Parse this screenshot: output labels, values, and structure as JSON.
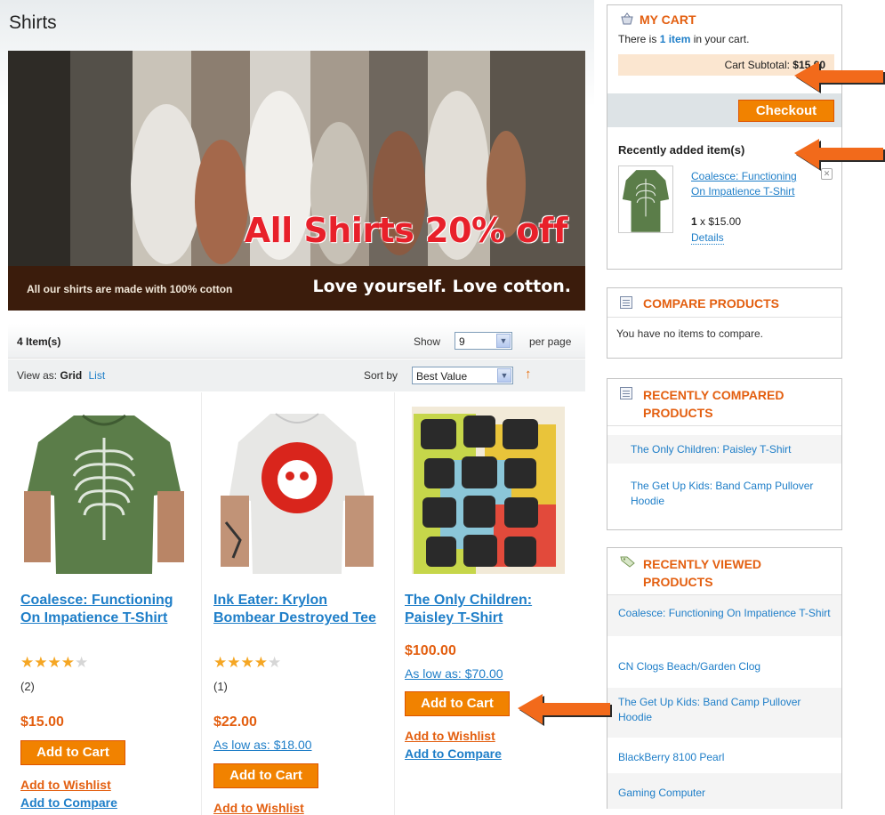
{
  "page": {
    "title": "Shirts"
  },
  "banner": {
    "headline": "All Shirts 20% off",
    "footer_left": "All our shirts are made with 100% cotton",
    "footer_right": "Love yourself. Love cotton."
  },
  "toolbar": {
    "item_count": "4 Item(s)",
    "show_label": "Show",
    "per_page_value": "9",
    "per_page_label": "per page",
    "view_as_label": "View as:",
    "view_grid": "Grid",
    "view_list": "List",
    "sort_label": "Sort by",
    "sort_value": "Best Value",
    "sort_dir_icon": "↑"
  },
  "products": [
    {
      "name": "Coalesce: Functioning On Impatience T-Shirt",
      "rating_stars": 4,
      "reviews": "(2)",
      "price": "$15.00",
      "as_low_as": "",
      "add_to_cart": "Add to Cart",
      "wishlist": "Add to Wishlist",
      "compare": "Add to Compare"
    },
    {
      "name": "Ink Eater: Krylon Bombear Destroyed Tee",
      "rating_stars": 4,
      "reviews": "(1)",
      "price": "$22.00",
      "as_low_as": "As low as: $18.00",
      "add_to_cart": "Add to Cart",
      "wishlist": "Add to Wishlist",
      "compare": ""
    },
    {
      "name": "The Only Children: Paisley T-Shirt",
      "rating_stars": 0,
      "reviews": "",
      "price": "$100.00",
      "as_low_as": "As low as: $70.00",
      "add_to_cart": "Add to Cart",
      "wishlist": "Add to Wishlist",
      "compare": "Add to Compare"
    }
  ],
  "cart": {
    "title": "MY CART",
    "text_before": "There is ",
    "item_link": "1 item",
    "text_after": " in your cart.",
    "subtotal_label": "Cart Subtotal:",
    "subtotal_value": "$15.00",
    "checkout": "Checkout",
    "recent_title": "Recently added item(s)",
    "recent_item": {
      "name": "Coalesce: Functioning On Impatience T-Shirt",
      "qty": "1",
      "qty_price": "x $15.00",
      "details": "Details",
      "remove_icon": "✕"
    }
  },
  "compare": {
    "title": "COMPARE PRODUCTS",
    "note": "You have no items to compare."
  },
  "recently_compared": {
    "title": "RECENTLY COMPARED PRODUCTS",
    "items": [
      "The Only Children: Paisley T-Shirt",
      "The Get Up Kids: Band Camp Pullover Hoodie"
    ]
  },
  "recently_viewed": {
    "title": "RECENTLY VIEWED PRODUCTS",
    "items": [
      "Coalesce: Functioning On Impatience T-Shirt",
      "CN Clogs Beach/Garden Clog",
      "The Get Up Kids: Band Camp Pullover Hoodie",
      "BlackBerry 8100 Pearl",
      "Gaming Computer"
    ]
  },
  "colors": {
    "accent_orange": "#f18200",
    "link_blue": "#1e7ec8",
    "price_orange": "#e35f10",
    "annotation_arrow": "#f26a1b"
  }
}
